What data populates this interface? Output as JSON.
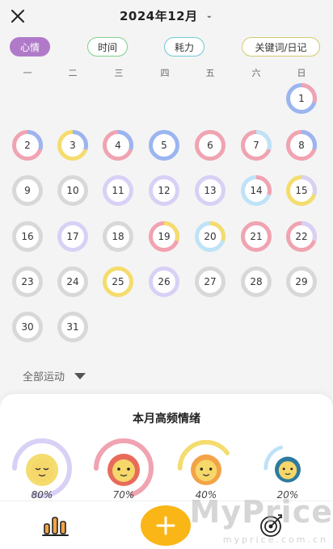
{
  "header": {
    "month_label": "2024年12月"
  },
  "filters": {
    "mood": "心情",
    "time": "时间",
    "energy": "耗力",
    "keyword": "关键词/日记"
  },
  "weekdays": [
    "一",
    "二",
    "三",
    "四",
    "五",
    "六",
    "日"
  ],
  "days": [
    {
      "n": "1",
      "colors": [
        "#9bb5f0",
        "#f0a3b1"
      ]
    },
    {
      "n": "2",
      "colors": [
        "#f0a3b1",
        "#9bb5f0"
      ]
    },
    {
      "n": "3",
      "colors": [
        "#f4dc6e",
        "#9bb5f0"
      ]
    },
    {
      "n": "4",
      "colors": [
        "#f0a3b1",
        "#9bb5f0"
      ]
    },
    {
      "n": "5",
      "colors": [
        "#9bb5f0",
        "#9bb5f0"
      ]
    },
    {
      "n": "6",
      "colors": [
        "#f0a3b1",
        "#f0a3b1"
      ]
    },
    {
      "n": "7",
      "colors": [
        "#f0a3b1",
        "#bfe2f7"
      ]
    },
    {
      "n": "8",
      "colors": [
        "#f0a3b1",
        "#9bb5f0"
      ]
    },
    {
      "n": "9",
      "colors": [
        "#d8d8d8",
        "#d8d8d8"
      ]
    },
    {
      "n": "10",
      "colors": [
        "#d8d8d8",
        "#d8d8d8"
      ]
    },
    {
      "n": "11",
      "colors": [
        "#d9d0f5",
        "#d9d0f5"
      ]
    },
    {
      "n": "12",
      "colors": [
        "#d9d0f5",
        "#d9d0f5"
      ]
    },
    {
      "n": "13",
      "colors": [
        "#d9d0f5",
        "#d9d0f5"
      ]
    },
    {
      "n": "14",
      "colors": [
        "#bfe2f7",
        "#f0a3b1"
      ]
    },
    {
      "n": "15",
      "colors": [
        "#f4dc6e",
        "#d9d0f5"
      ]
    },
    {
      "n": "16",
      "colors": [
        "#d8d8d8",
        "#d8d8d8"
      ]
    },
    {
      "n": "17",
      "colors": [
        "#d9d0f5",
        "#d9d0f5"
      ]
    },
    {
      "n": "18",
      "colors": [
        "#d8d8d8",
        "#d8d8d8"
      ]
    },
    {
      "n": "19",
      "colors": [
        "#f0a3b1",
        "#f4dc6e"
      ]
    },
    {
      "n": "20",
      "colors": [
        "#bfe2f7",
        "#f4dc6e"
      ]
    },
    {
      "n": "21",
      "colors": [
        "#f0a3b1",
        "#f0a3b1"
      ]
    },
    {
      "n": "22",
      "colors": [
        "#f0a3b1",
        "#d9d0f5"
      ]
    },
    {
      "n": "23",
      "colors": [
        "#d8d8d8",
        "#d8d8d8"
      ]
    },
    {
      "n": "24",
      "colors": [
        "#d8d8d8",
        "#d8d8d8"
      ]
    },
    {
      "n": "25",
      "colors": [
        "#f4dc6e",
        "#f4dc6e"
      ]
    },
    {
      "n": "26",
      "colors": [
        "#d9d0f5",
        "#d9d0f5"
      ]
    },
    {
      "n": "27",
      "colors": [
        "#d8d8d8",
        "#d8d8d8"
      ]
    },
    {
      "n": "28",
      "colors": [
        "#d8d8d8",
        "#d8d8d8"
      ]
    },
    {
      "n": "29",
      "colors": [
        "#d8d8d8",
        "#d8d8d8"
      ]
    },
    {
      "n": "30",
      "colors": [
        "#d8d8d8",
        "#d8d8d8"
      ]
    },
    {
      "n": "31",
      "colors": [
        "#d8d8d8",
        "#d8d8d8"
      ]
    }
  ],
  "sport_filter": "全部运动",
  "summary": {
    "title": "本月高频情绪",
    "emotions": [
      {
        "pct": "80%",
        "ring": "#d9d0f5",
        "face": "#f4dc6e",
        "expr": "calm"
      },
      {
        "pct": "70%",
        "ring": "#f0a3b1",
        "face": "#e86b5a",
        "expr": "happy"
      },
      {
        "pct": "40%",
        "ring": "#f4dc6e",
        "face": "#f3a347",
        "expr": "happy"
      },
      {
        "pct": "20%",
        "ring": "#bfe2f7",
        "face": "#2e7aa0",
        "expr": "happy"
      }
    ]
  },
  "watermark": {
    "big": "MyPrice",
    "small": "myprice.com.cn"
  }
}
